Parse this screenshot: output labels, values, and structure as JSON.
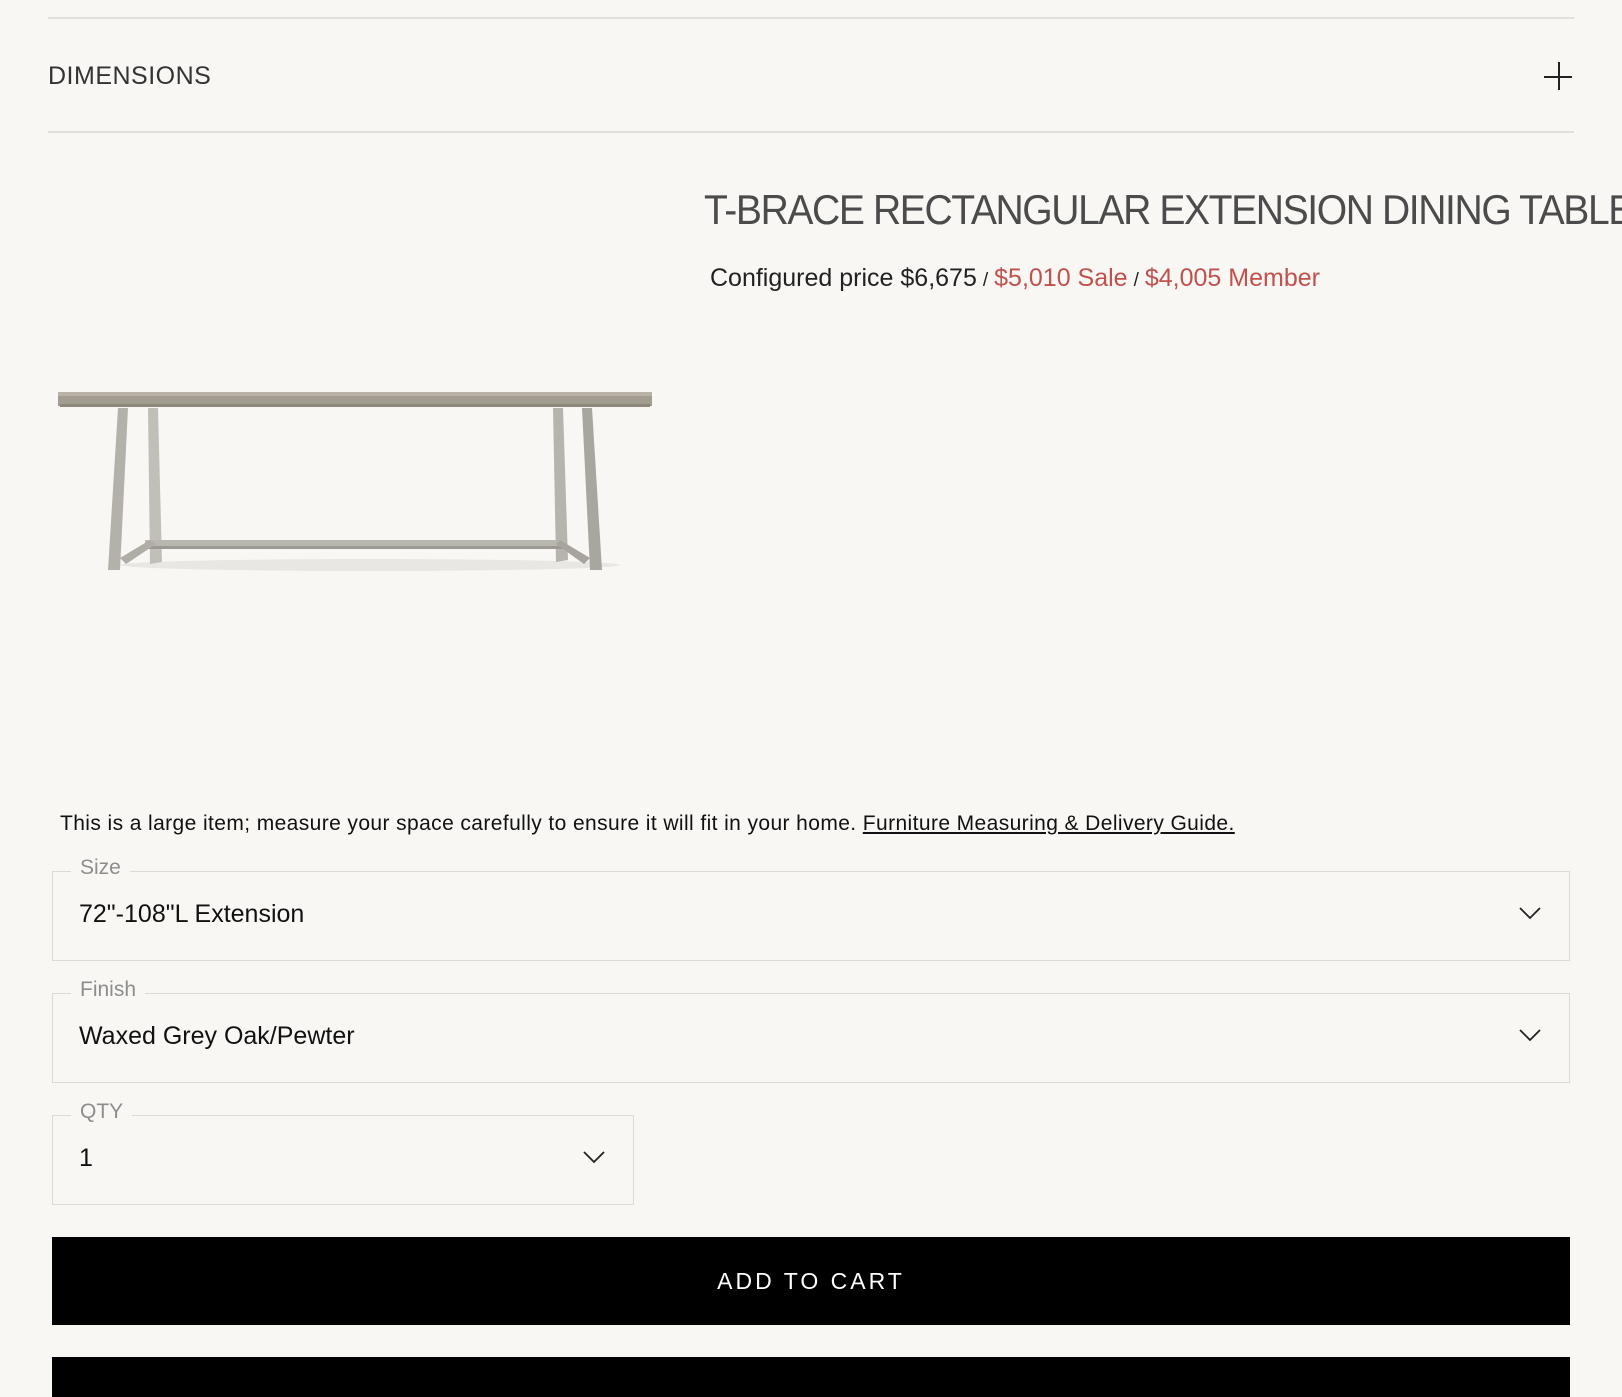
{
  "accordion": {
    "label": "DIMENSIONS"
  },
  "product": {
    "title": "T-BRACE RECTANGULAR EXTENSION DINING TABLE",
    "price_label": "Configured price $6,675",
    "sale_price": "$5,010 Sale",
    "member_price": "$4,005 Member",
    "separator": "/",
    "image_alt": "T-Brace rectangular extension dining table"
  },
  "notice": {
    "text": "This is a large item; measure your space carefully to ensure it will fit in your home. ",
    "link": "Furniture Measuring & Delivery Guide."
  },
  "options": {
    "size": {
      "label": "Size",
      "value": "72\"-108\"L Extension"
    },
    "finish": {
      "label": "Finish",
      "value": "Waxed Grey Oak/Pewter"
    },
    "qty": {
      "label": "QTY",
      "value": "1"
    }
  },
  "cart": {
    "add_label": "ADD TO CART"
  },
  "colors": {
    "sale": "#c1514c",
    "button": "#000000",
    "background": "#f8f7f4"
  }
}
